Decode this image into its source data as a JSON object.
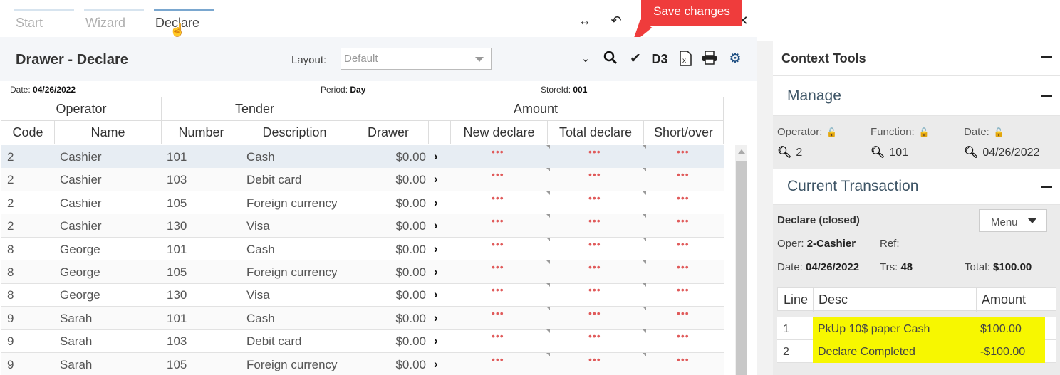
{
  "tabs": [
    {
      "label": "Start"
    },
    {
      "label": "Wizard"
    },
    {
      "label": "Declare"
    }
  ],
  "tooltip": {
    "text": "Save changes"
  },
  "panel": {
    "title": "Drawer - Declare",
    "layout_label": "Layout:",
    "layout_value": "Default"
  },
  "meta": {
    "date_label": "Date:",
    "date_value": "04/26/2022",
    "period_label": "Period:",
    "period_value": "Day",
    "store_label": "StoreId:",
    "store_value": "001"
  },
  "grid": {
    "group_headers": [
      "Operator",
      "Tender",
      "Amount"
    ],
    "columns": [
      "Code",
      "Name",
      "Number",
      "Description",
      "Drawer",
      "New declare",
      "Total declare",
      "Short/over"
    ],
    "rows": [
      {
        "code": "2",
        "name": "Cashier",
        "number": "101",
        "description": "Cash",
        "drawer": "$0.00"
      },
      {
        "code": "2",
        "name": "Cashier",
        "number": "103",
        "description": "Debit card",
        "drawer": "$0.00"
      },
      {
        "code": "2",
        "name": "Cashier",
        "number": "105",
        "description": "Foreign currency",
        "drawer": "$0.00"
      },
      {
        "code": "2",
        "name": "Cashier",
        "number": "130",
        "description": "Visa",
        "drawer": "$0.00"
      },
      {
        "code": "8",
        "name": "George",
        "number": "101",
        "description": "Cash",
        "drawer": "$0.00"
      },
      {
        "code": "8",
        "name": "George",
        "number": "105",
        "description": "Foreign currency",
        "drawer": "$0.00"
      },
      {
        "code": "8",
        "name": "George",
        "number": "130",
        "description": "Visa",
        "drawer": "$0.00"
      },
      {
        "code": "9",
        "name": "Sarah",
        "number": "101",
        "description": "Cash",
        "drawer": "$0.00"
      },
      {
        "code": "9",
        "name": "Sarah",
        "number": "103",
        "description": "Debit card",
        "drawer": "$0.00"
      },
      {
        "code": "9",
        "name": "Sarah",
        "number": "105",
        "description": "Foreign currency",
        "drawer": "$0.00"
      }
    ],
    "dots": "•••"
  },
  "context": {
    "title": "Context Tools",
    "manage": {
      "title": "Manage",
      "operator_label": "Operator:",
      "operator_value": "2",
      "function_label": "Function:",
      "function_value": "101",
      "date_label": "Date:",
      "date_value": "04/26/2022"
    },
    "transaction": {
      "title": "Current Transaction",
      "status": "Declare (closed)",
      "menu_label": "Menu",
      "oper_label": "Oper:",
      "oper_value": "2-Cashier",
      "ref_label": "Ref:",
      "date_label": "Date:",
      "date_value": "04/26/2022",
      "trs_label": "Trs:",
      "trs_value": "48",
      "total_label": "Total:",
      "total_value": "$100.00",
      "table_headers": [
        "Line",
        "Desc",
        "Amount"
      ],
      "lines": [
        {
          "line": "1",
          "desc": "PkUp 10$ paper Cash",
          "amount": "$100.00"
        },
        {
          "line": "2",
          "desc": "Declare Completed",
          "amount": "-$100.00"
        }
      ]
    }
  },
  "icons": {
    "expand": "expand-horizontal-icon",
    "undo": "undo-icon",
    "close": "close-icon",
    "collapse": "double-chevron-down-icon",
    "search": "search-icon",
    "save": "checkmark-icon",
    "d3": "d3-icon",
    "excel": "excel-export-icon",
    "print": "print-icon",
    "settings": "settings-gears-icon",
    "lock": "unlock-icon",
    "highlight_color": "#f7f700",
    "tooltip_color": "#ef3c3c"
  }
}
